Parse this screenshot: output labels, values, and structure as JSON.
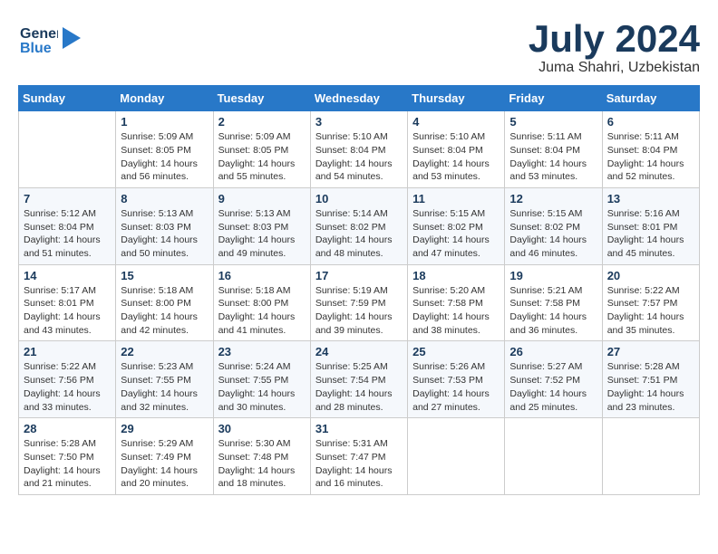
{
  "header": {
    "logo_general": "General",
    "logo_blue": "Blue",
    "title": "July 2024",
    "subtitle": "Juma Shahri, Uzbekistan"
  },
  "calendar": {
    "days_of_week": [
      "Sunday",
      "Monday",
      "Tuesday",
      "Wednesday",
      "Thursday",
      "Friday",
      "Saturday"
    ],
    "weeks": [
      [
        {
          "day": "",
          "sunrise": "",
          "sunset": "",
          "daylight": ""
        },
        {
          "day": "1",
          "sunrise": "Sunrise: 5:09 AM",
          "sunset": "Sunset: 8:05 PM",
          "daylight": "Daylight: 14 hours and 56 minutes."
        },
        {
          "day": "2",
          "sunrise": "Sunrise: 5:09 AM",
          "sunset": "Sunset: 8:05 PM",
          "daylight": "Daylight: 14 hours and 55 minutes."
        },
        {
          "day": "3",
          "sunrise": "Sunrise: 5:10 AM",
          "sunset": "Sunset: 8:04 PM",
          "daylight": "Daylight: 14 hours and 54 minutes."
        },
        {
          "day": "4",
          "sunrise": "Sunrise: 5:10 AM",
          "sunset": "Sunset: 8:04 PM",
          "daylight": "Daylight: 14 hours and 53 minutes."
        },
        {
          "day": "5",
          "sunrise": "Sunrise: 5:11 AM",
          "sunset": "Sunset: 8:04 PM",
          "daylight": "Daylight: 14 hours and 53 minutes."
        },
        {
          "day": "6",
          "sunrise": "Sunrise: 5:11 AM",
          "sunset": "Sunset: 8:04 PM",
          "daylight": "Daylight: 14 hours and 52 minutes."
        }
      ],
      [
        {
          "day": "7",
          "sunrise": "Sunrise: 5:12 AM",
          "sunset": "Sunset: 8:04 PM",
          "daylight": "Daylight: 14 hours and 51 minutes."
        },
        {
          "day": "8",
          "sunrise": "Sunrise: 5:13 AM",
          "sunset": "Sunset: 8:03 PM",
          "daylight": "Daylight: 14 hours and 50 minutes."
        },
        {
          "day": "9",
          "sunrise": "Sunrise: 5:13 AM",
          "sunset": "Sunset: 8:03 PM",
          "daylight": "Daylight: 14 hours and 49 minutes."
        },
        {
          "day": "10",
          "sunrise": "Sunrise: 5:14 AM",
          "sunset": "Sunset: 8:02 PM",
          "daylight": "Daylight: 14 hours and 48 minutes."
        },
        {
          "day": "11",
          "sunrise": "Sunrise: 5:15 AM",
          "sunset": "Sunset: 8:02 PM",
          "daylight": "Daylight: 14 hours and 47 minutes."
        },
        {
          "day": "12",
          "sunrise": "Sunrise: 5:15 AM",
          "sunset": "Sunset: 8:02 PM",
          "daylight": "Daylight: 14 hours and 46 minutes."
        },
        {
          "day": "13",
          "sunrise": "Sunrise: 5:16 AM",
          "sunset": "Sunset: 8:01 PM",
          "daylight": "Daylight: 14 hours and 45 minutes."
        }
      ],
      [
        {
          "day": "14",
          "sunrise": "Sunrise: 5:17 AM",
          "sunset": "Sunset: 8:01 PM",
          "daylight": "Daylight: 14 hours and 43 minutes."
        },
        {
          "day": "15",
          "sunrise": "Sunrise: 5:18 AM",
          "sunset": "Sunset: 8:00 PM",
          "daylight": "Daylight: 14 hours and 42 minutes."
        },
        {
          "day": "16",
          "sunrise": "Sunrise: 5:18 AM",
          "sunset": "Sunset: 8:00 PM",
          "daylight": "Daylight: 14 hours and 41 minutes."
        },
        {
          "day": "17",
          "sunrise": "Sunrise: 5:19 AM",
          "sunset": "Sunset: 7:59 PM",
          "daylight": "Daylight: 14 hours and 39 minutes."
        },
        {
          "day": "18",
          "sunrise": "Sunrise: 5:20 AM",
          "sunset": "Sunset: 7:58 PM",
          "daylight": "Daylight: 14 hours and 38 minutes."
        },
        {
          "day": "19",
          "sunrise": "Sunrise: 5:21 AM",
          "sunset": "Sunset: 7:58 PM",
          "daylight": "Daylight: 14 hours and 36 minutes."
        },
        {
          "day": "20",
          "sunrise": "Sunrise: 5:22 AM",
          "sunset": "Sunset: 7:57 PM",
          "daylight": "Daylight: 14 hours and 35 minutes."
        }
      ],
      [
        {
          "day": "21",
          "sunrise": "Sunrise: 5:22 AM",
          "sunset": "Sunset: 7:56 PM",
          "daylight": "Daylight: 14 hours and 33 minutes."
        },
        {
          "day": "22",
          "sunrise": "Sunrise: 5:23 AM",
          "sunset": "Sunset: 7:55 PM",
          "daylight": "Daylight: 14 hours and 32 minutes."
        },
        {
          "day": "23",
          "sunrise": "Sunrise: 5:24 AM",
          "sunset": "Sunset: 7:55 PM",
          "daylight": "Daylight: 14 hours and 30 minutes."
        },
        {
          "day": "24",
          "sunrise": "Sunrise: 5:25 AM",
          "sunset": "Sunset: 7:54 PM",
          "daylight": "Daylight: 14 hours and 28 minutes."
        },
        {
          "day": "25",
          "sunrise": "Sunrise: 5:26 AM",
          "sunset": "Sunset: 7:53 PM",
          "daylight": "Daylight: 14 hours and 27 minutes."
        },
        {
          "day": "26",
          "sunrise": "Sunrise: 5:27 AM",
          "sunset": "Sunset: 7:52 PM",
          "daylight": "Daylight: 14 hours and 25 minutes."
        },
        {
          "day": "27",
          "sunrise": "Sunrise: 5:28 AM",
          "sunset": "Sunset: 7:51 PM",
          "daylight": "Daylight: 14 hours and 23 minutes."
        }
      ],
      [
        {
          "day": "28",
          "sunrise": "Sunrise: 5:28 AM",
          "sunset": "Sunset: 7:50 PM",
          "daylight": "Daylight: 14 hours and 21 minutes."
        },
        {
          "day": "29",
          "sunrise": "Sunrise: 5:29 AM",
          "sunset": "Sunset: 7:49 PM",
          "daylight": "Daylight: 14 hours and 20 minutes."
        },
        {
          "day": "30",
          "sunrise": "Sunrise: 5:30 AM",
          "sunset": "Sunset: 7:48 PM",
          "daylight": "Daylight: 14 hours and 18 minutes."
        },
        {
          "day": "31",
          "sunrise": "Sunrise: 5:31 AM",
          "sunset": "Sunset: 7:47 PM",
          "daylight": "Daylight: 14 hours and 16 minutes."
        },
        {
          "day": "",
          "sunrise": "",
          "sunset": "",
          "daylight": ""
        },
        {
          "day": "",
          "sunrise": "",
          "sunset": "",
          "daylight": ""
        },
        {
          "day": "",
          "sunrise": "",
          "sunset": "",
          "daylight": ""
        }
      ]
    ]
  }
}
